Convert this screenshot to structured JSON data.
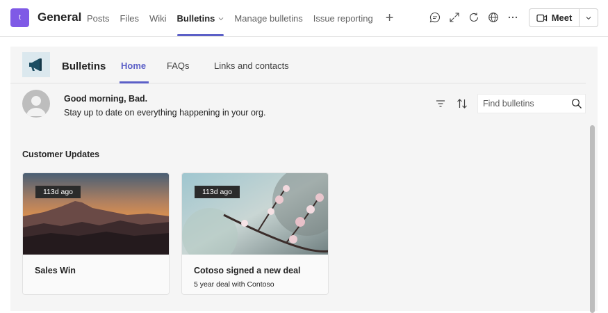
{
  "header": {
    "team_avatar_letter": "t",
    "channel_name": "General",
    "tabs": [
      {
        "label": "Posts"
      },
      {
        "label": "Files"
      },
      {
        "label": "Wiki"
      },
      {
        "label": "Bulletins"
      },
      {
        "label": "Manage bulletins"
      },
      {
        "label": "Issue reporting"
      }
    ],
    "add_tab": "+",
    "meet_label": "Meet",
    "icons": [
      "chat-icon",
      "expand-icon",
      "refresh-icon",
      "globe-icon",
      "more-icon"
    ]
  },
  "app": {
    "title": "Bulletins",
    "tabs": [
      {
        "label": "Home"
      },
      {
        "label": "FAQs"
      },
      {
        "label": "Links and contacts"
      }
    ],
    "greeting": "Good morning, Bad.",
    "subtitle": "Stay up to date on everything happening in your org.",
    "search_placeholder": "Find bulletins",
    "section_title": "Customer Updates",
    "cards": [
      {
        "badge": "113d ago",
        "title": "Sales Win",
        "subtitle": ""
      },
      {
        "badge": "113d ago",
        "title": "Cotoso signed a new deal",
        "subtitle": "5 year deal with Contoso"
      }
    ]
  },
  "colors": {
    "accent": "#5b5fc7",
    "team_avatar": "#7f5ae6",
    "app_background": "#f5f5f5"
  }
}
